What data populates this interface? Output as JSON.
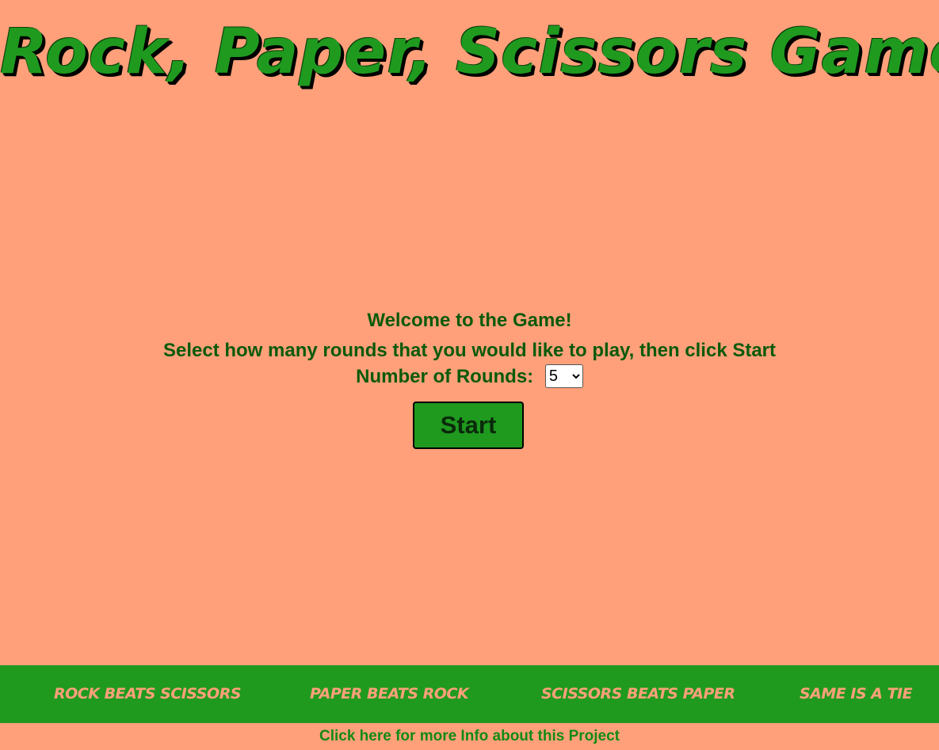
{
  "header": {
    "title": "Rock, Paper, Scissors Game"
  },
  "setup": {
    "welcome": "Welcome to the Game!",
    "instruction": "Select how many rounds that you would like to play, then click Start",
    "rounds_label": "Number of Rounds:",
    "rounds_selected": "5",
    "start_label": "Start"
  },
  "rules": [
    {
      "text": "Rock beats Scissors"
    },
    {
      "text": "Paper beats Rock"
    },
    {
      "text": "Scissors beats Paper"
    },
    {
      "text": "Same is a tie"
    }
  ],
  "footer": {
    "link_text": "Click here for more Info about this Project"
  },
  "colors": {
    "background": "#ffa07a",
    "accent_green": "#1f9a1f",
    "text_green": "#0b5a0b"
  }
}
